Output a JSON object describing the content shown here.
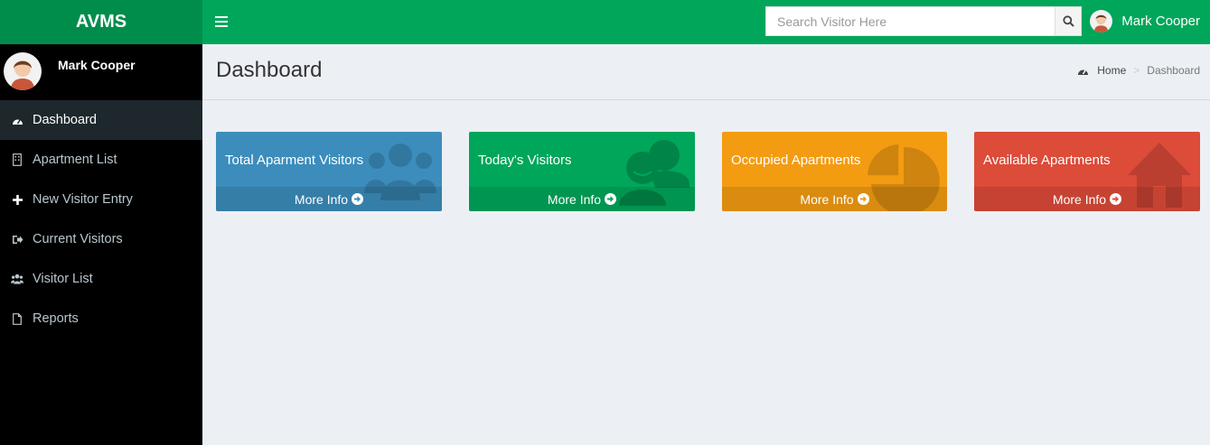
{
  "app": {
    "logo": "AVMS"
  },
  "header": {
    "search_placeholder": "Search Visitor Here",
    "user_name": "Mark Cooper"
  },
  "sidebar": {
    "user_name": "Mark Cooper",
    "items": [
      {
        "label": "Dashboard",
        "icon": "dashboard-icon",
        "active": true
      },
      {
        "label": "Apartment List",
        "icon": "building-icon"
      },
      {
        "label": "New Visitor Entry",
        "icon": "plus-icon"
      },
      {
        "label": "Current Visitors",
        "icon": "sign-in-icon"
      },
      {
        "label": "Visitor List",
        "icon": "users-icon"
      },
      {
        "label": "Reports",
        "icon": "file-icon"
      }
    ]
  },
  "content": {
    "title": "Dashboard",
    "breadcrumb": {
      "home": "Home",
      "current": "Dashboard"
    }
  },
  "boxes": [
    {
      "title": "Total Aparment Visitors",
      "footer": "More Info",
      "color": "#3c8dbc",
      "icon": "users-icon"
    },
    {
      "title": "Today's Visitors",
      "footer": "More Info",
      "color": "#00a65a",
      "icon": "chat-users-icon"
    },
    {
      "title": "Occupied Apartments",
      "footer": "More Info",
      "color": "#f39c12",
      "icon": "pie-chart-icon"
    },
    {
      "title": "Available Apartments",
      "footer": "More Info",
      "color": "#dd4b39",
      "icon": "home-icon"
    }
  ],
  "colors": {
    "brand": "#00a65a",
    "brand_dark": "#008d4c",
    "sidebar": "#000000"
  }
}
